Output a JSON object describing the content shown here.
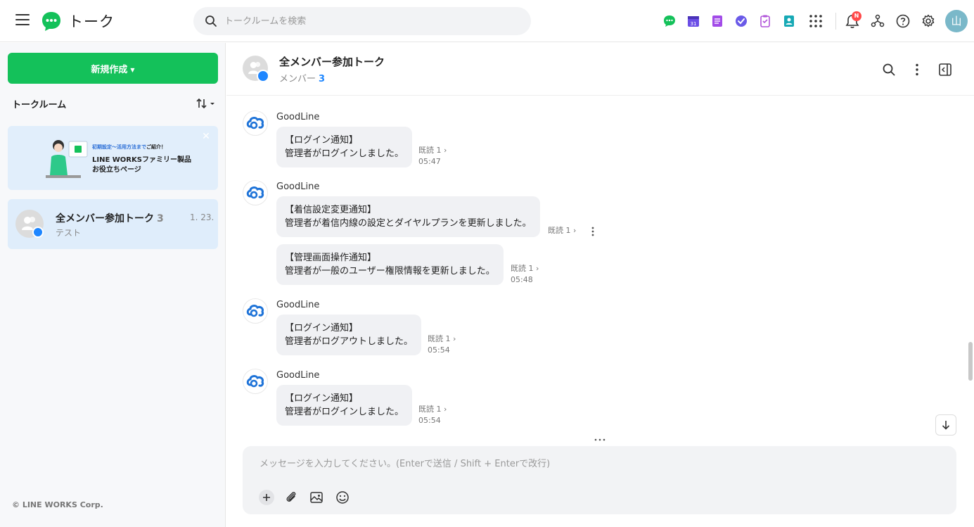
{
  "header": {
    "app_title": "トーク",
    "search_placeholder": "トークルームを検索",
    "notification_badge": "N",
    "user_avatar_text": "山",
    "app_icons": [
      "talk-icon",
      "calendar-icon",
      "note-icon",
      "task-icon",
      "survey-icon",
      "contacts-icon"
    ],
    "calendar_day": "31"
  },
  "sidebar": {
    "new_button_label": "新規作成",
    "section_title": "トークルーム",
    "banner": {
      "line1_blue": "初期設定～活用方法まで",
      "line1_dark": "ご紹介！",
      "line2": "LINE WORKSファミリー製品",
      "line3": "お役立ちページ"
    },
    "rooms": [
      {
        "name": "全メンバー参加トーク",
        "count": "3",
        "date": "1. 23.",
        "preview": "テスト"
      }
    ],
    "copyright": "© LINE WORKS Corp."
  },
  "chat": {
    "title": "全メンバー参加トーク",
    "members_label": "メンバー",
    "members_count": "3",
    "messages": [
      {
        "sender": "GoodLine",
        "line1": "【ログイン通知】",
        "line2": "管理者がログインしました。",
        "read": "既読 1 ›",
        "time": "05:47"
      },
      {
        "sender": "GoodLine",
        "line1": "【着信設定変更通知】",
        "line2": "管理者が着信内線の設定とダイヤルプランを更新しました。",
        "read": "既読 1 ›",
        "time": ""
      },
      {
        "sender": "",
        "line1": "【管理画面操作通知】",
        "line2": "管理者が一般のユーザー権限情報を更新しました。",
        "read": "既読 1 ›",
        "time": "05:48"
      },
      {
        "sender": "GoodLine",
        "line1": "【ログイン通知】",
        "line2": "管理者がログアウトしました。",
        "read": "既読 1 ›",
        "time": "05:54"
      },
      {
        "sender": "GoodLine",
        "line1": "【ログイン通知】",
        "line2": "管理者がログインしました。",
        "read": "既読 1 ›",
        "time": "05:54"
      }
    ],
    "composer_placeholder": "メッセージを入力してください。(Enterで送信 / Shift + Enterで改行)"
  },
  "colors": {
    "brand_green": "#14c15a",
    "accent_blue": "#1e86ff",
    "selected_room_bg": "#dfedfb",
    "bubble_bg": "#f0f1f4"
  }
}
